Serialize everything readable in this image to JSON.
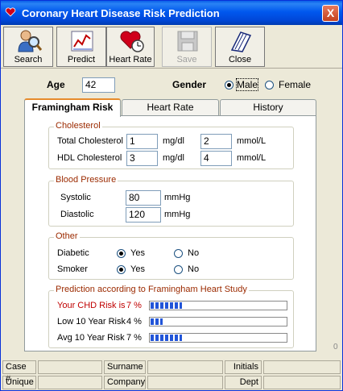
{
  "window": {
    "title": "Coronary Heart Disease Risk Prediction",
    "close_glyph": "X"
  },
  "toolbar": {
    "search": "Search",
    "predict": "Predict",
    "heart_rate": "Heart Rate",
    "save": "Save",
    "close": "Close"
  },
  "patient": {
    "age_label": "Age",
    "age_value": "42",
    "gender_label": "Gender",
    "male": "Male",
    "female": "Female",
    "gender_selected": "Male"
  },
  "tabs": [
    {
      "label": "Framingham Risk",
      "active": true
    },
    {
      "label": "Heart Rate",
      "active": false
    },
    {
      "label": "History",
      "active": false
    }
  ],
  "cholesterol": {
    "title": "Cholesterol",
    "total_label": "Total Cholesterol",
    "total_mgdl": "1",
    "total_mmol": "2",
    "hdl_label": "HDL Cholesterol",
    "hdl_mgdl": "3",
    "hdl_mmol": "4",
    "unit_mgdl": "mg/dl",
    "unit_mmol": "mmol/L"
  },
  "blood_pressure": {
    "title": "Blood Pressure",
    "systolic_label": "Systolic",
    "systolic_value": "80",
    "diastolic_label": "Diastolic",
    "diastolic_value": "120",
    "unit": "mmHg"
  },
  "other": {
    "title": "Other",
    "diabetic_label": "Diabetic",
    "smoker_label": "Smoker",
    "yes": "Yes",
    "no": "No",
    "diabetic_selected": "Yes",
    "smoker_selected": "Yes"
  },
  "prediction": {
    "title": "Prediction according to Framingham Heart Study",
    "your_risk_label": "Your CHD Risk is",
    "your_risk_value": "7 %",
    "your_risk_fraction": 0.23,
    "low_label": "Low 10 Year Risk",
    "low_value": "4 %",
    "low_fraction": 0.09,
    "avg_label": "Avg 10 Year Risk",
    "avg_value": "7 %",
    "avg_fraction": 0.23,
    "risk_color": "#c00000",
    "bar_color": "#2255d8"
  },
  "side_marker": "0",
  "statusbar": {
    "case_label": "Case #",
    "surname_label": "Surname",
    "initials_label": "Initials",
    "unique_label": "Unique",
    "company_label": "Company",
    "dept_label": "Dept"
  }
}
